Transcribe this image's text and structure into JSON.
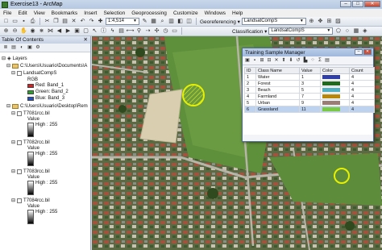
{
  "window": {
    "title": "Exercise13 - ArcMap",
    "controls": [
      "–",
      "□",
      "✕"
    ]
  },
  "menubar": [
    "File",
    "Edit",
    "View",
    "Bookmarks",
    "Insert",
    "Selection",
    "Geoprocessing",
    "Customize",
    "Windows",
    "Help"
  ],
  "toolbar1": {
    "scale": "1:4,514",
    "georeferencing_label": "Georeferencing ▾",
    "georef_layer": "LandsatCompS"
  },
  "toolbar2": {
    "classification_label": "Classification ▾",
    "class_layer": "LandsatCompS"
  },
  "toc": {
    "title": "Table Of Contents",
    "close": "✕",
    "layers_label": "Layers",
    "folder1": "C:\\Users\\Usuario\\Documents\\A",
    "landsat_name": "LandsatCompS",
    "rgb_label": "RGB",
    "bands": [
      {
        "label": "Red:   Band_1",
        "color": "#d42020"
      },
      {
        "label": "Green: Band_2",
        "color": "#2ca02c"
      },
      {
        "label": "Blue:  Band_3",
        "color": "#1f4fc8"
      }
    ],
    "folder2": "C:\\Users\\Usuario\\Desktop\\Rem",
    "rasters": [
      {
        "name": "T7081rcc.bil",
        "value_label": "Value",
        "high": "High : 255"
      },
      {
        "name": "T7082rcc.bil",
        "value_label": "Value",
        "high": "High : 255"
      },
      {
        "name": "T7083rcc.bil",
        "value_label": "Value",
        "high": "High : 255"
      },
      {
        "name": "T7084rcc.bil",
        "value_label": "Value",
        "high": "High : 255"
      }
    ]
  },
  "tsm": {
    "title": "Training Sample Manager",
    "columns": [
      "ID",
      "Class Name",
      "Value",
      "Color",
      "Count"
    ],
    "rows": [
      {
        "id": "1",
        "name": "Water",
        "value": "1",
        "color": "#2f3ea8",
        "count": "4"
      },
      {
        "id": "2",
        "name": "Forest",
        "value": "3",
        "color": "#1f6a1f",
        "count": "4"
      },
      {
        "id": "3",
        "name": "Beach",
        "value": "5",
        "color": "#4fb0c4",
        "count": "4"
      },
      {
        "id": "4",
        "name": "Farmland",
        "value": "7",
        "color": "#b8860b",
        "count": "4"
      },
      {
        "id": "5",
        "name": "Urban",
        "value": "9",
        "color": "#9a7d74",
        "count": "4"
      },
      {
        "id": "6",
        "name": "Grassland",
        "value": "11",
        "color": "#7ac943",
        "count": "4"
      }
    ]
  },
  "colors": {
    "accent": "#4e6b94",
    "selection_yellow": "#e6f000"
  }
}
